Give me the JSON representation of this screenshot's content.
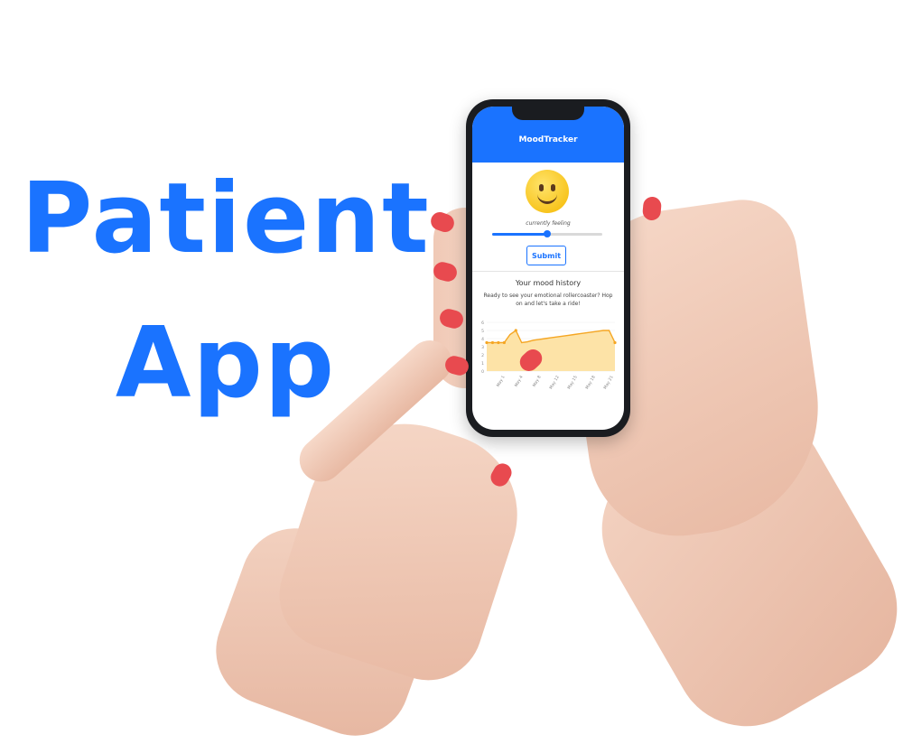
{
  "headline": {
    "line1": "Patient",
    "line2": "App"
  },
  "app": {
    "title": "MoodTracker",
    "mood": {
      "emoji": "slightly-smiling-face-icon",
      "caption": "currently feeling",
      "slider_value": 0.5,
      "submit_label": "Submit"
    },
    "history": {
      "title": "Your mood history",
      "subtitle": "Ready to see your emotional rollercoaster? Hop on and let's take a ride!"
    }
  },
  "colors": {
    "brand": "#1a73ff",
    "line": "#f5a623",
    "fill": "#fde3a7",
    "nail": "#e84a4f"
  },
  "chart_data": {
    "type": "area",
    "ylim": [
      0,
      6
    ],
    "yticks": [
      0,
      1,
      2,
      3,
      4,
      5,
      6
    ],
    "xticks": [
      "May 1",
      "May 4",
      "May 8",
      "May 12",
      "May 15",
      "May 18",
      "May 21"
    ],
    "x": [
      0,
      1,
      2,
      3,
      4,
      5,
      6,
      7,
      8,
      9,
      10,
      11,
      12,
      13,
      14,
      15,
      16,
      17,
      18,
      19,
      20,
      21,
      22
    ],
    "values": [
      3.5,
      3.5,
      3.5,
      3.5,
      4.5,
      5,
      3.5,
      3.6,
      3.8,
      3.9,
      4.0,
      4.1,
      4.2,
      4.3,
      4.4,
      4.5,
      4.6,
      4.7,
      4.8,
      4.9,
      5.0,
      5.0,
      3.5
    ],
    "grid": true
  }
}
